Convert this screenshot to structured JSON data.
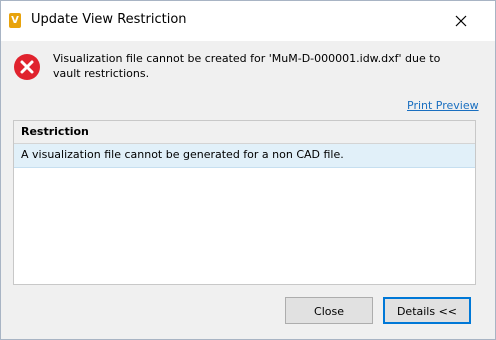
{
  "window": {
    "title": "Update View Restriction",
    "app_icon_letter": "V",
    "app_icon_color": "#e8a30c",
    "close_icon": "close-icon"
  },
  "message": {
    "icon": "error-icon",
    "icon_color": "#e0232e",
    "text": "Visualization file cannot be created for 'MuM-D-000001.idw.dxf' due to vault restrictions."
  },
  "print_preview_label": "Print Preview",
  "restrictions": {
    "column_header": "Restriction",
    "rows": [
      "A visualization file cannot be generated for a non CAD file."
    ],
    "selected_row_color": "#e1f0f9"
  },
  "buttons": {
    "close_label": "Close",
    "details_label": "Details <<"
  },
  "colors": {
    "link": "#1a6fc0",
    "focus_border": "#0078d7"
  }
}
